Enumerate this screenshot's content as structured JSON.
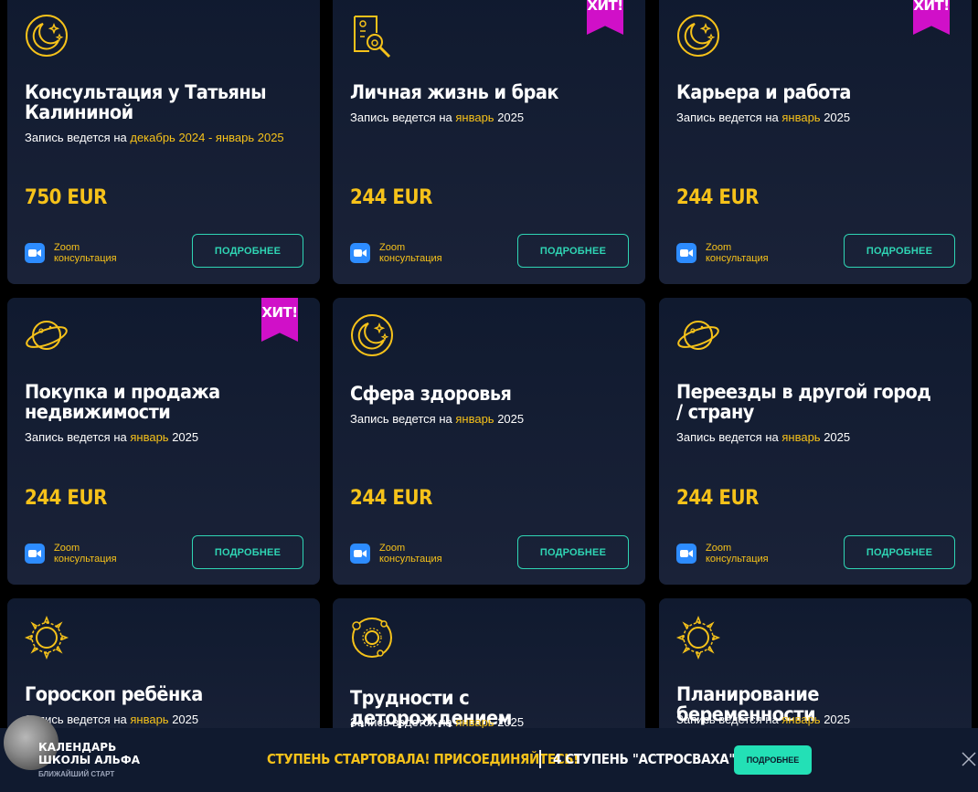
{
  "cards": [
    {
      "title": "Консультация у Татьяны Калининой",
      "schedule_prefix": "Запись ведется на",
      "schedule_hl": "декабрь 2024 - январь 2025",
      "schedule_suffix": "",
      "price": "750 EUR",
      "zoom_line1": "Zoom",
      "zoom_line2": "консультация",
      "button": "ПОДРОБНЕЕ",
      "badge": "",
      "icon": "moon-stars-icon"
    },
    {
      "title": "Личная жизнь и брак",
      "schedule_prefix": "Запись ведется на",
      "schedule_hl": "январь",
      "schedule_suffix": "2025",
      "price": "244 EUR",
      "zoom_line1": "Zoom",
      "zoom_line2": "консультация",
      "button": "ПОДРОБНЕЕ",
      "badge": "ХИТ!",
      "icon": "scroll-magnifier-icon"
    },
    {
      "title": "Карьера и работа",
      "schedule_prefix": "Запись ведется на",
      "schedule_hl": "январь",
      "schedule_suffix": "2025",
      "price": "244 EUR",
      "zoom_line1": "Zoom",
      "zoom_line2": "консультация",
      "button": "ПОДРОБНЕЕ",
      "badge": "ХИТ!",
      "icon": "moon-stars-icon"
    },
    {
      "title": "Покупка и продажа недвижимости",
      "schedule_prefix": "Запись ведется на",
      "schedule_hl": "январь",
      "schedule_suffix": "2025",
      "price": "244 EUR",
      "zoom_line1": "Zoom",
      "zoom_line2": "консультация",
      "button": "ПОДРОБНЕЕ",
      "badge": "ХИТ!",
      "icon": "planet-ring-icon"
    },
    {
      "title": "Сфера здоровья",
      "schedule_prefix": "Запись ведется на",
      "schedule_hl": "январь",
      "schedule_suffix": "2025",
      "price": "244 EUR",
      "zoom_line1": "Zoom",
      "zoom_line2": "консультация",
      "button": "ПОДРОБНЕЕ",
      "badge": "",
      "icon": "moon-stars-icon"
    },
    {
      "title": "Переезды в другой город / страну",
      "schedule_prefix": "Запись ведется на",
      "schedule_hl": "январь",
      "schedule_suffix": "2025",
      "price": "244 EUR",
      "zoom_line1": "Zoom",
      "zoom_line2": "консультация",
      "button": "ПОДРОБНЕЕ",
      "badge": "",
      "icon": "planet-ring-icon"
    },
    {
      "title": "Гороскоп ребёнка",
      "schedule_prefix": "Запись ведется на",
      "schedule_hl": "январь",
      "schedule_suffix": "2025",
      "price": "",
      "zoom_line1": "",
      "zoom_line2": "",
      "button": "",
      "badge": "",
      "icon": "sun-icon"
    },
    {
      "title": "Трудности с деторождением",
      "schedule_prefix": "Запись ведется на",
      "schedule_hl": "январь",
      "schedule_suffix": "2025",
      "price": "",
      "zoom_line1": "",
      "zoom_line2": "",
      "button": "",
      "badge": "",
      "icon": "orbit-sun-icon"
    },
    {
      "title": "Планирование беременности",
      "schedule_prefix": "Запись ведется на",
      "schedule_hl": "январь",
      "schedule_suffix": "2025",
      "price": "",
      "zoom_line1": "",
      "zoom_line2": "",
      "button": "",
      "badge": "",
      "icon": "sun-icon"
    }
  ],
  "bottom_bar": {
    "calendar_title_1": "КАЛЕНДАРЬ",
    "calendar_title_2": "ШКОЛЫ АЛЬФА",
    "calendar_sub": "БЛИЖАЙШИЙ СТАРТ",
    "promo": "СТУПЕНЬ СТАРТОВАЛА! ПРИСОЕДИНЯЙТЕСЬ!",
    "stage": "4 СТУПЕНЬ \"АСТРОСВАХА\".",
    "button": "ПОДРОБНЕЕ"
  },
  "colors": {
    "accent": "#f6c21a",
    "teal": "#2fd5b4",
    "badge": "#d010c8",
    "card": "#141d33"
  }
}
